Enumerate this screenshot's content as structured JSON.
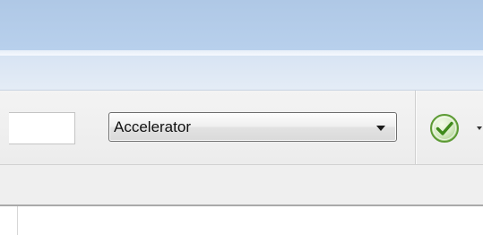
{
  "window": {
    "title_bar_color": "#afc8e6"
  },
  "toolbar": {
    "search": {
      "value": "",
      "placeholder": ""
    },
    "engine_dropdown": {
      "selected": "Accelerator"
    },
    "confirm_button": {
      "icon": "green-check-circle-icon"
    },
    "confirm_menu": {
      "icon": "chevron-down-icon"
    }
  }
}
